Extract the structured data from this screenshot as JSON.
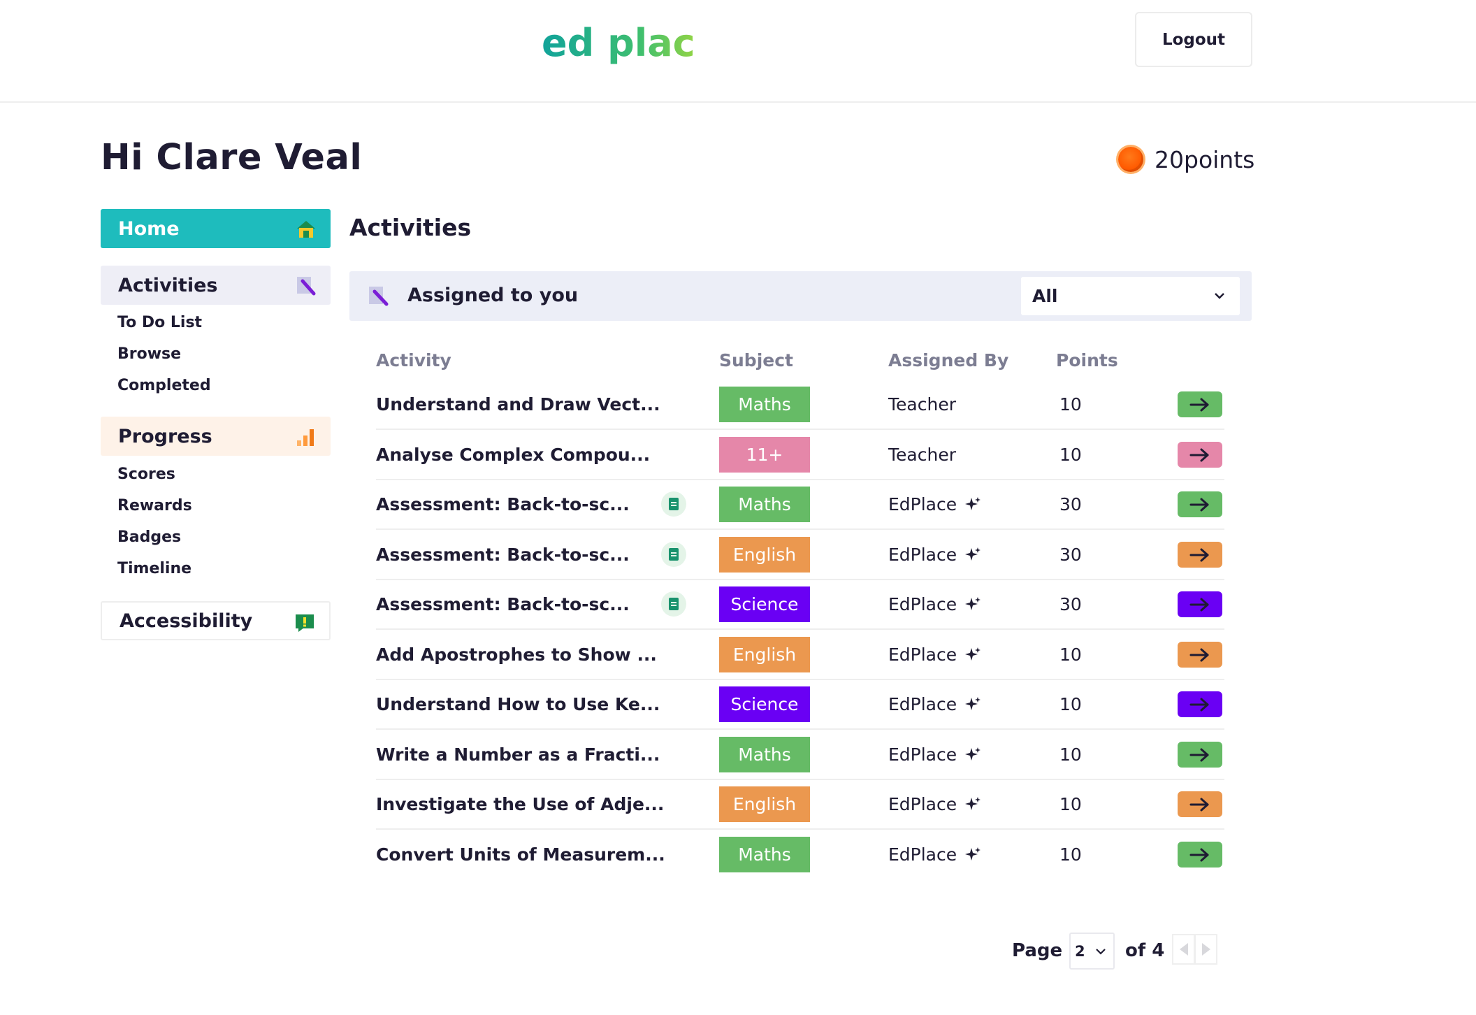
{
  "header": {
    "logo_text": "ed place",
    "logout_label": "Logout"
  },
  "greeting": "Hi Clare Veal",
  "points": {
    "value_text": "20points"
  },
  "sidebar": {
    "home": {
      "label": "Home",
      "icon": "home-icon"
    },
    "activities": {
      "label": "Activities",
      "icon": "pencil-icon",
      "links": [
        "To Do List",
        "Browse",
        "Completed"
      ]
    },
    "progress": {
      "label": "Progress",
      "icon": "bar-chart-icon",
      "links": [
        "Scores",
        "Rewards",
        "Badges",
        "Timeline"
      ]
    },
    "accessibility": {
      "label": "Accessibility",
      "icon": "feedback-icon"
    }
  },
  "main": {
    "title": "Activities",
    "assigned_label": "Assigned to you",
    "filter": {
      "selected": "All"
    },
    "columns": [
      "Activity",
      "Subject",
      "Assigned By",
      "Points"
    ],
    "rows": [
      {
        "title": "Understand and Draw Vect...",
        "subject": "Maths",
        "assigned_by": "Teacher",
        "points": "10",
        "assessment": false,
        "sparkle": false
      },
      {
        "title": "Analyse Complex Compou...",
        "subject": "11+",
        "assigned_by": "Teacher",
        "points": "10",
        "assessment": false,
        "sparkle": false
      },
      {
        "title": "Assessment: Back-to-sc...",
        "subject": "Maths",
        "assigned_by": "EdPlace",
        "points": "30",
        "assessment": true,
        "sparkle": true
      },
      {
        "title": "Assessment: Back-to-sc...",
        "subject": "English",
        "assigned_by": "EdPlace",
        "points": "30",
        "assessment": true,
        "sparkle": true
      },
      {
        "title": "Assessment: Back-to-sc...",
        "subject": "Science",
        "assigned_by": "EdPlace",
        "points": "30",
        "assessment": true,
        "sparkle": true
      },
      {
        "title": "Add Apostrophes to Show ...",
        "subject": "English",
        "assigned_by": "EdPlace",
        "points": "10",
        "assessment": false,
        "sparkle": true
      },
      {
        "title": "Understand How to Use Ke...",
        "subject": "Science",
        "assigned_by": "EdPlace",
        "points": "10",
        "assessment": false,
        "sparkle": true
      },
      {
        "title": "Write a Number as a Fracti...",
        "subject": "Maths",
        "assigned_by": "EdPlace",
        "points": "10",
        "assessment": false,
        "sparkle": true
      },
      {
        "title": "Investigate the Use of Adje...",
        "subject": "English",
        "assigned_by": "EdPlace",
        "points": "10",
        "assessment": false,
        "sparkle": true
      },
      {
        "title": "Convert Units of Measurem...",
        "subject": "Maths",
        "assigned_by": "EdPlace",
        "points": "10",
        "assessment": false,
        "sparkle": true
      }
    ]
  },
  "subject_colors": {
    "Maths": "#66bb66",
    "11+": "#e587a9",
    "English": "#eb984f",
    "Science": "#6a00f4"
  },
  "pagination": {
    "page_label": "Page",
    "current": "2",
    "of_label": "of 4"
  },
  "colors": {
    "accent_teal": "#1ebcbd",
    "text_dark": "#1f1c33",
    "muted": "#7c7d92"
  }
}
